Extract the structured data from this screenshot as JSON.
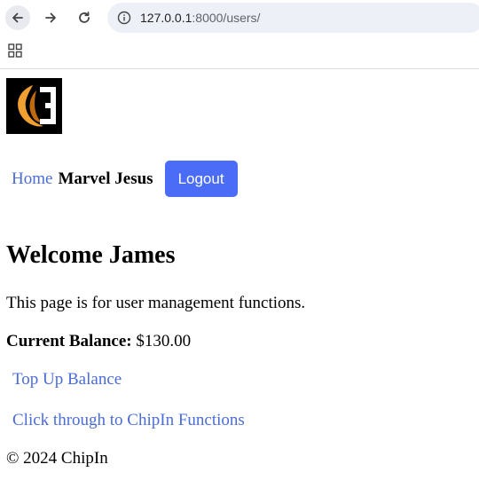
{
  "browser": {
    "url_host": "127.0.0.1",
    "url_rest": ":8000/users/"
  },
  "nav": {
    "home_label": "Home",
    "user_name": "Marvel Jesus",
    "logout_label": "Logout"
  },
  "main": {
    "welcome": "Welcome James",
    "description": "This page is for user management functions.",
    "balance_label": "Current Balance:",
    "balance_value": "$130.00",
    "topup_link": "Top Up Balance",
    "chipin_link": "Click through to ChipIn Functions"
  },
  "footer": {
    "text": "© 2024 ChipIn"
  },
  "colors": {
    "link": "#4a6cd8",
    "button": "#4a6cf7",
    "logo_orange": "#f0a030"
  }
}
